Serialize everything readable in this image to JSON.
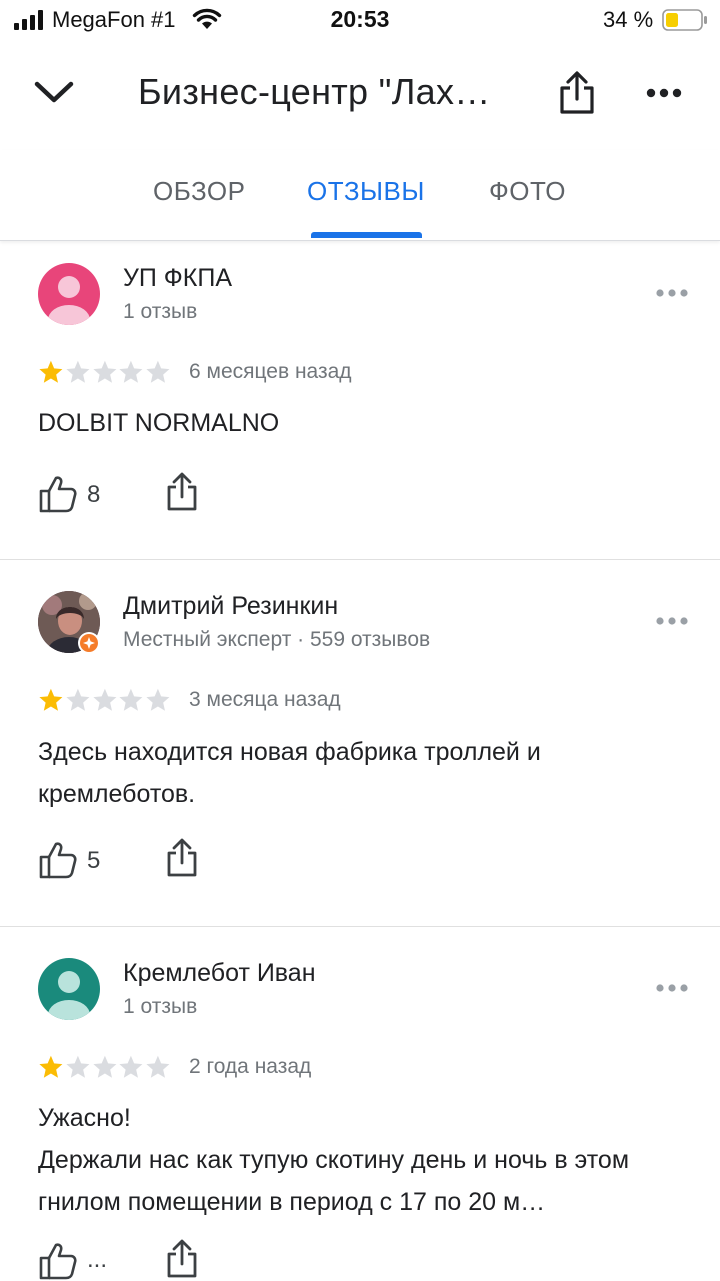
{
  "status_bar": {
    "carrier": "MegaFon #1",
    "time": "20:53",
    "battery": "34 %",
    "battery_level": 0.34
  },
  "header": {
    "title": "Бизнес-центр \"Лах…",
    "icons": [
      "chevron-down-icon",
      "share-icon",
      "more-horizontal-icon"
    ]
  },
  "tabs": [
    {
      "label": "ОБЗОР",
      "active": false
    },
    {
      "label": "ОТЗЫВЫ",
      "active": true
    },
    {
      "label": "ФОТО",
      "active": false
    }
  ],
  "colors": {
    "accent": "#1a73e8",
    "star_filled": "#fbbc04",
    "star_empty": "#dadce0",
    "avatar_1": "#e8457a",
    "avatar_3": "#1a8a7c"
  },
  "reviews": [
    {
      "author": "УП ФКПА",
      "meta": "1 отзыв",
      "rating": 1,
      "date": "6 месяцев назад",
      "text": "DOLBIT NORMALNO",
      "likes": "8"
    },
    {
      "author": "Дмитрий Резинкин",
      "meta": "Местный эксперт · 559 отзывов",
      "rating": 1,
      "date": "3 месяца назад",
      "text": "Здесь находится новая фабрика троллей и кремлеботов.",
      "likes": "5"
    },
    {
      "author": "Кремлебот Иван",
      "meta": "1 отзыв",
      "rating": 1,
      "date": "2 года назад",
      "text_line1": "Ужасно!",
      "text_line2": "Держали нас как тупую скотину  день и ночь в этом гнилом помещении в период с 17 по 20 м…",
      "likes": "..."
    }
  ]
}
